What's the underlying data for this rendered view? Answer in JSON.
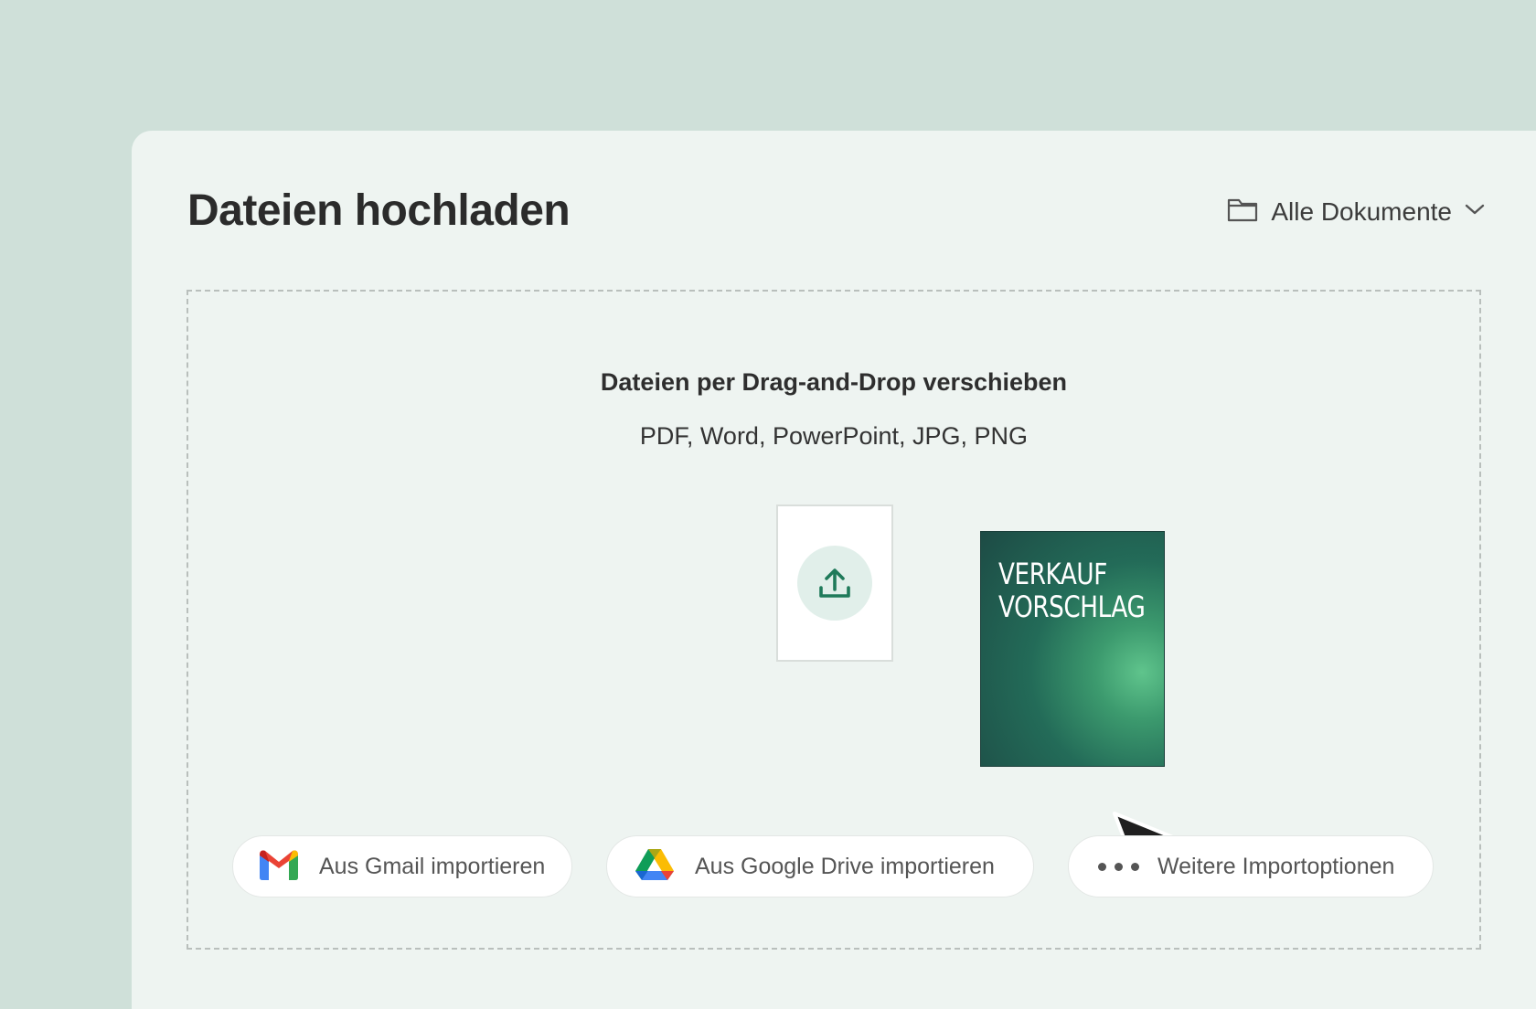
{
  "header": {
    "title": "Dateien hochladen",
    "folder_select_label": "Alle Dokumente",
    "folder_icon": "folder-icon",
    "dropdown_icon": "chevron-down-icon"
  },
  "dropzone": {
    "title": "Dateien per Drag-and-Drop verschieben",
    "formats": "PDF, Word, PowerPoint, JPG, PNG",
    "upload_icon": "upload-icon",
    "dragged_document": {
      "title": "VERKAUF\nVORSCHLAG"
    }
  },
  "import_options": [
    {
      "label": "Aus Gmail importieren",
      "icon": "gmail-icon"
    },
    {
      "label": "Aus Google Drive importieren",
      "icon": "google-drive-icon"
    },
    {
      "label": "Weitere Importoptionen",
      "icon": "more-dots-icon"
    }
  ],
  "colors": {
    "background": "#cfe0d9",
    "panel": "#eef4f1",
    "accent": "#1f7a5a",
    "upload_circle": "#e1efea"
  }
}
